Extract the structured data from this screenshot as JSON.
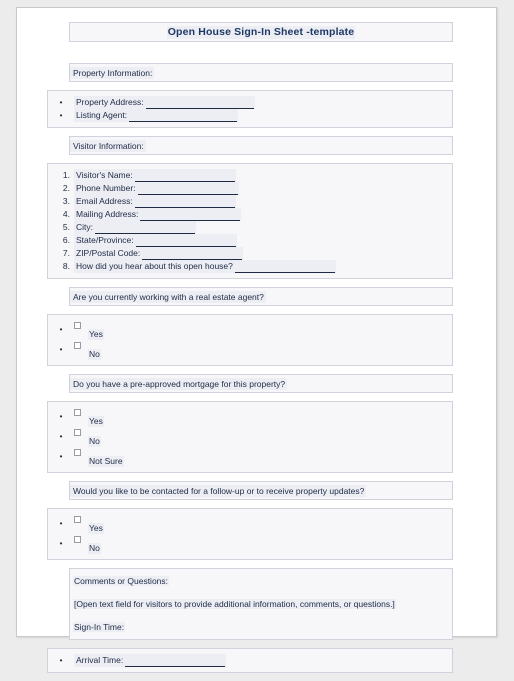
{
  "document": {
    "title": "Open House Sign-In Sheet -template",
    "sections": {
      "property_information_heading": "Property Information:",
      "visitor_information_heading": "Visitor Information:",
      "question_agent": "Are you currently working with a real estate agent?",
      "question_mortgage": "Do you have a pre-approved mortgage for this property?",
      "question_contact": "Would you like to be contacted for a follow-up or to receive property updates?",
      "comments_heading": "Comments or Questions:",
      "comments_placeholder_text": "[Open text field for visitors to provide additional information, comments, or questions.]",
      "sign_in_time_label": "Sign-In Time:"
    },
    "property_fields": [
      {
        "marker": "•",
        "label": "Property Address:",
        "rule_width": 108
      },
      {
        "marker": "•",
        "label": "Listing Agent:",
        "rule_width": 108
      }
    ],
    "visitor_fields": [
      {
        "marker": "1.",
        "label": "Visitor's Name:",
        "rule_width": 100
      },
      {
        "marker": "2.",
        "label": "Phone Number:",
        "rule_width": 100
      },
      {
        "marker": "3.",
        "label": "Email Address:",
        "rule_width": 100
      },
      {
        "marker": "4.",
        "label": "Mailing Address:",
        "rule_width": 100
      },
      {
        "marker": "5.",
        "label": "City:",
        "rule_width": 100
      },
      {
        "marker": "6.",
        "label": "State/Province:",
        "rule_width": 100
      },
      {
        "marker": "7.",
        "label": "ZIP/Postal Code:",
        "rule_width": 100
      },
      {
        "marker": "8.",
        "label": "How did you hear about this open house?",
        "rule_width": 100
      }
    ],
    "agent_options": [
      {
        "marker": "•",
        "label": "Yes"
      },
      {
        "marker": "•",
        "label": "No"
      }
    ],
    "mortgage_options": [
      {
        "marker": "•",
        "label": "Yes"
      },
      {
        "marker": "•",
        "label": "No"
      },
      {
        "marker": "•",
        "label": "Not Sure"
      }
    ],
    "contact_options": [
      {
        "marker": "•",
        "label": "Yes"
      },
      {
        "marker": "•",
        "label": "No"
      }
    ],
    "arrival_fields": [
      {
        "marker": "•",
        "label": "Arrival Time:",
        "rule_width": 100
      }
    ],
    "colors": {
      "page_background": "#ececed",
      "sheet": "#ffffff",
      "box_fill": "#f7f7f9",
      "box_border": "#d2d2dc",
      "title_text": "#1f3864",
      "body_text": "#1f2a44",
      "text_highlight": "#eceef4"
    }
  }
}
